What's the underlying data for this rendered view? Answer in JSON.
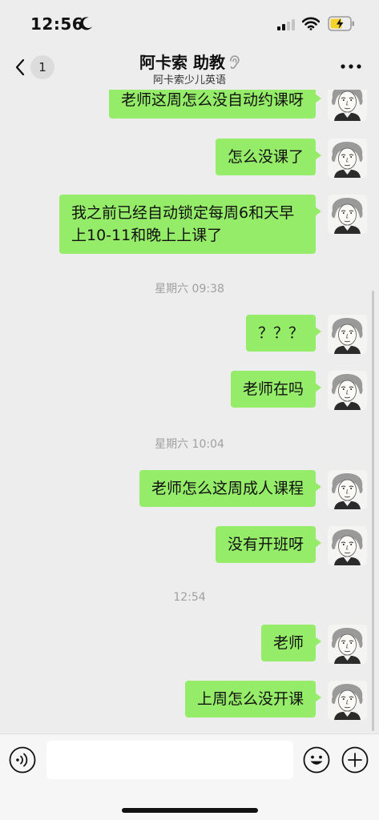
{
  "status": {
    "time": "12:56"
  },
  "header": {
    "back_badge": "1",
    "title": "阿卡索 助教",
    "subtitle": "阿卡索少儿英语"
  },
  "messages": [
    {
      "type": "text",
      "sender": "me",
      "text": "老师这周怎么没自动约课呀"
    },
    {
      "type": "text",
      "sender": "me",
      "text": "怎么没课了"
    },
    {
      "type": "text",
      "sender": "me",
      "text": "我之前已经自动锁定每周6和天早上10-11和晚上上课了"
    },
    {
      "type": "time",
      "text": "星期六 09:38"
    },
    {
      "type": "text",
      "sender": "me",
      "text": "？？？"
    },
    {
      "type": "text",
      "sender": "me",
      "text": "老师在吗"
    },
    {
      "type": "time",
      "text": "星期六 10:04"
    },
    {
      "type": "text",
      "sender": "me",
      "text": "老师怎么这周成人课程"
    },
    {
      "type": "text",
      "sender": "me",
      "text": "没有开班呀"
    },
    {
      "type": "time",
      "text": "12:54"
    },
    {
      "type": "text",
      "sender": "me",
      "text": "老师"
    },
    {
      "type": "text",
      "sender": "me",
      "text": "上周怎么没开课"
    }
  ],
  "input": {
    "value": "",
    "placeholder": ""
  },
  "icons": {
    "back": "chevron-left-icon",
    "listen": "ear-icon",
    "more": "more-dots-icon",
    "voice": "voice-icon",
    "emoji": "emoji-icon",
    "plus": "plus-icon"
  },
  "colors": {
    "background": "#ededed",
    "my_bubble": "#95ec69",
    "timestamp": "#a0a0a0"
  }
}
